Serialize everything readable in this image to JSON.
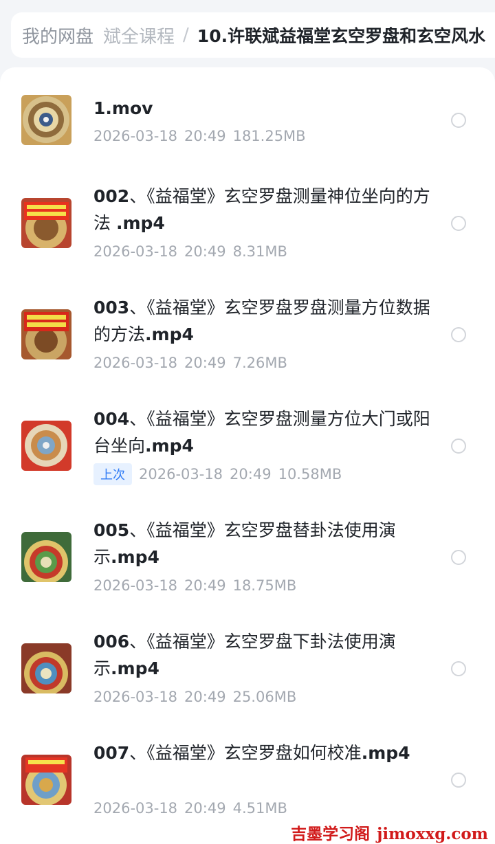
{
  "breadcrumb": {
    "root": "我的网盘",
    "middle": "斌全课程",
    "separator": "/",
    "current": "10.许联斌益福堂玄空罗盘和玄空风水"
  },
  "files": [
    {
      "prefix": "",
      "title": "",
      "ext": "1.mov",
      "date": "2026-03-18",
      "time": "20:49",
      "size": "181.25MB",
      "badge": ""
    },
    {
      "prefix": "002",
      "title": "、《益福堂》玄空罗盘测量神位坐向的方法 ",
      "ext": ".mp4",
      "date": "2026-03-18",
      "time": "20:49",
      "size": "8.31MB",
      "badge": ""
    },
    {
      "prefix": "003",
      "title": "、《益福堂》玄空罗盘罗盘测量方位数据的方法",
      "ext": ".mp4",
      "date": "2026-03-18",
      "time": "20:49",
      "size": "7.26MB",
      "badge": ""
    },
    {
      "prefix": "004",
      "title": "、《益福堂》玄空罗盘测量方位大门或阳台坐向",
      "ext": ".mp4",
      "date": "2026-03-18",
      "time": "20:49",
      "size": "10.58MB",
      "badge": "上次"
    },
    {
      "prefix": "005",
      "title": "、《益福堂》玄空罗盘替卦法使用演示",
      "ext": ".mp4",
      "date": "2026-03-18",
      "time": "20:49",
      "size": "18.75MB",
      "badge": ""
    },
    {
      "prefix": "006",
      "title": "、《益福堂》玄空罗盘下卦法使用演示",
      "ext": ".mp4",
      "date": "2026-03-18",
      "time": "20:49",
      "size": "25.06MB",
      "badge": ""
    },
    {
      "prefix": "007",
      "title": "、《益福堂》玄空罗盘如何校准",
      "ext": ".mp4",
      "date": "2026-03-18",
      "time": "20:49",
      "size": "4.51MB",
      "badge": ""
    }
  ],
  "watermark": {
    "cn": "吉墨学习阁",
    "en": "jimoxxg.com"
  },
  "colors": {
    "accent": "#2f7bf5",
    "badge_bg": "#e7f1ff",
    "watermark": "#d11a1a"
  }
}
